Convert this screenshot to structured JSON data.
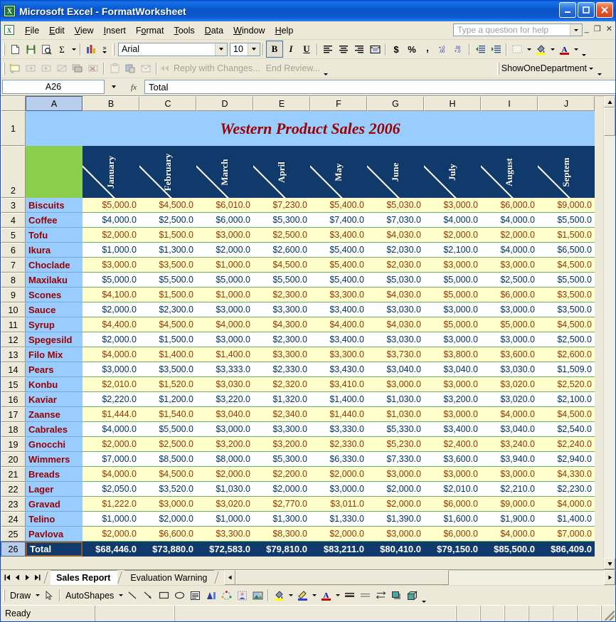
{
  "window": {
    "title": "Microsoft Excel - FormatWorksheet",
    "app_icon": "excel-icon",
    "minimize_label": "_",
    "maximize_label": "□",
    "close_label": "✕"
  },
  "menubar": {
    "items": [
      {
        "label": "File",
        "accel": "F"
      },
      {
        "label": "Edit",
        "accel": "E"
      },
      {
        "label": "View",
        "accel": "V"
      },
      {
        "label": "Insert",
        "accel": "I"
      },
      {
        "label": "Format",
        "accel": "o"
      },
      {
        "label": "Tools",
        "accel": "T"
      },
      {
        "label": "Data",
        "accel": "D"
      },
      {
        "label": "Window",
        "accel": "W"
      },
      {
        "label": "Help",
        "accel": "H"
      }
    ],
    "ask_placeholder": "Type a question for help",
    "doc_minimize": "_",
    "doc_restore": "❐",
    "doc_close": "✕"
  },
  "toolbar": {
    "buttons": [
      {
        "name": "new-icon",
        "label": "New"
      },
      {
        "name": "save-icon",
        "label": "Save"
      },
      {
        "name": "print-preview-icon",
        "label": "Print Preview"
      },
      {
        "name": "autosum-icon",
        "label": "AutoSum"
      },
      {
        "name": "chart-wizard-icon",
        "label": "Chart Wizard"
      }
    ],
    "overflow_label": "»",
    "font_name": "Arial",
    "font_size": "10",
    "bold_label": "B",
    "italic_label": "I",
    "underline_label": "U",
    "align_left": "Align Left",
    "align_center": "Center",
    "align_right": "Align Right",
    "merge_center": "Merge and Center",
    "currency_label": "$",
    "percent_label": "%",
    "comma_label": ",",
    "increase_decimal": "Increase Decimal",
    "decrease_decimal": "Decrease Decimal",
    "decrease_indent": "Decrease Indent",
    "increase_indent": "Increase Indent",
    "borders_label": "Borders",
    "fill_color_label": "Fill Color",
    "font_color_label": "A"
  },
  "reviewing_toolbar": {
    "reply_with_changes": "Reply with Changes...",
    "end_review": "End Review...",
    "macro_button": "ShowOneDepartment"
  },
  "formula_bar": {
    "name_box": "A26",
    "fx_label": "fx",
    "formula_value": "Total"
  },
  "grid": {
    "column_headers": [
      "A",
      "B",
      "C",
      "D",
      "E",
      "F",
      "G",
      "H",
      "I",
      "J"
    ],
    "selected_column": "A",
    "selected_row": "26",
    "row_numbers": [
      "1",
      "2",
      "3",
      "4",
      "5",
      "6",
      "7",
      "8",
      "9",
      "10",
      "11",
      "12",
      "13",
      "14",
      "15",
      "16",
      "17",
      "18",
      "19",
      "20",
      "21",
      "22",
      "23",
      "24",
      "25",
      "26"
    ],
    "sheet_title": "Western Product Sales 2006",
    "month_headers": [
      "January",
      "February",
      "March",
      "April",
      "May",
      "June",
      "July",
      "August",
      "Septem"
    ],
    "total_label": "Total"
  },
  "chart_data": {
    "type": "table",
    "title": "Western Product Sales 2006",
    "categories": [
      "January",
      "February",
      "March",
      "April",
      "May",
      "June",
      "July",
      "August",
      "Septem"
    ],
    "rows": [
      {
        "row": "3",
        "product": "Biscuits",
        "values": [
          "$5,000.0",
          "$4,500.0",
          "$6,010.0",
          "$7,230.0",
          "$5,400.0",
          "$5,030.0",
          "$3,000.0",
          "$6,000.0",
          "$9,000.0"
        ]
      },
      {
        "row": "4",
        "product": "Coffee",
        "values": [
          "$4,000.0",
          "$2,500.0",
          "$6,000.0",
          "$5,300.0",
          "$7,400.0",
          "$7,030.0",
          "$4,000.0",
          "$4,000.0",
          "$5,500.0"
        ]
      },
      {
        "row": "5",
        "product": "Tofu",
        "values": [
          "$2,000.0",
          "$1,500.0",
          "$3,000.0",
          "$2,500.0",
          "$3,400.0",
          "$4,030.0",
          "$2,000.0",
          "$2,000.0",
          "$1,500.0"
        ]
      },
      {
        "row": "6",
        "product": "Ikura",
        "values": [
          "$1,000.0",
          "$1,300.0",
          "$2,000.0",
          "$2,600.0",
          "$5,400.0",
          "$2,030.0",
          "$2,100.0",
          "$4,000.0",
          "$6,500.0"
        ]
      },
      {
        "row": "7",
        "product": "Choclade",
        "values": [
          "$3,000.0",
          "$3,500.0",
          "$1,000.0",
          "$4,500.0",
          "$5,400.0",
          "$2,030.0",
          "$3,000.0",
          "$3,000.0",
          "$4,500.0"
        ]
      },
      {
        "row": "8",
        "product": "Maxilaku",
        "values": [
          "$5,000.0",
          "$5,500.0",
          "$5,000.0",
          "$5,500.0",
          "$5,400.0",
          "$5,030.0",
          "$5,000.0",
          "$2,500.0",
          "$5,500.0"
        ]
      },
      {
        "row": "9",
        "product": "Scones",
        "values": [
          "$4,100.0",
          "$1,500.0",
          "$1,000.0",
          "$2,300.0",
          "$3,300.0",
          "$4,030.0",
          "$5,000.0",
          "$6,000.0",
          "$3,500.0"
        ]
      },
      {
        "row": "10",
        "product": "Sauce",
        "values": [
          "$2,000.0",
          "$2,300.0",
          "$3,000.0",
          "$3,300.0",
          "$3,400.0",
          "$3,030.0",
          "$3,000.0",
          "$3,000.0",
          "$3,500.0"
        ]
      },
      {
        "row": "11",
        "product": "Syrup",
        "values": [
          "$4,400.0",
          "$4,500.0",
          "$4,000.0",
          "$4,300.0",
          "$4,400.0",
          "$4,030.0",
          "$5,000.0",
          "$5,000.0",
          "$4,500.0"
        ]
      },
      {
        "row": "12",
        "product": "Spegesild",
        "values": [
          "$2,000.0",
          "$1,500.0",
          "$3,000.0",
          "$2,300.0",
          "$3,400.0",
          "$3,030.0",
          "$3,000.0",
          "$3,000.0",
          "$2,500.0"
        ]
      },
      {
        "row": "13",
        "product": "Filo Mix",
        "values": [
          "$4,000.0",
          "$1,400.0",
          "$1,400.0",
          "$3,300.0",
          "$3,300.0",
          "$3,730.0",
          "$3,800.0",
          "$3,600.0",
          "$2,600.0"
        ]
      },
      {
        "row": "14",
        "product": "Pears",
        "values": [
          "$3,000.0",
          "$3,500.0",
          "$3,333.0",
          "$2,330.0",
          "$3,430.0",
          "$3,040.0",
          "$3,040.0",
          "$3,030.0",
          "$1,509.0"
        ]
      },
      {
        "row": "15",
        "product": "Konbu",
        "values": [
          "$2,010.0",
          "$1,520.0",
          "$3,030.0",
          "$2,320.0",
          "$3,410.0",
          "$3,000.0",
          "$3,000.0",
          "$3,020.0",
          "$2,520.0"
        ]
      },
      {
        "row": "16",
        "product": "Kaviar",
        "values": [
          "$2,220.0",
          "$1,200.0",
          "$3,220.0",
          "$1,320.0",
          "$1,400.0",
          "$1,030.0",
          "$3,200.0",
          "$3,020.0",
          "$2,100.0"
        ]
      },
      {
        "row": "17",
        "product": "Zaanse",
        "values": [
          "$1,444.0",
          "$1,540.0",
          "$3,040.0",
          "$2,340.0",
          "$1,440.0",
          "$1,030.0",
          "$3,000.0",
          "$4,000.0",
          "$4,500.0"
        ]
      },
      {
        "row": "18",
        "product": "Cabrales",
        "values": [
          "$4,000.0",
          "$5,500.0",
          "$3,000.0",
          "$3,300.0",
          "$3,330.0",
          "$5,330.0",
          "$3,400.0",
          "$3,040.0",
          "$2,540.0"
        ]
      },
      {
        "row": "19",
        "product": "Gnocchi",
        "values": [
          "$2,000.0",
          "$2,500.0",
          "$3,200.0",
          "$3,200.0",
          "$2,330.0",
          "$5,230.0",
          "$2,400.0",
          "$3,240.0",
          "$2,240.0"
        ]
      },
      {
        "row": "20",
        "product": "Wimmers",
        "values": [
          "$7,000.0",
          "$8,500.0",
          "$8,000.0",
          "$5,300.0",
          "$6,330.0",
          "$7,330.0",
          "$3,600.0",
          "$3,940.0",
          "$2,940.0"
        ]
      },
      {
        "row": "21",
        "product": "Breads",
        "values": [
          "$4,000.0",
          "$4,500.0",
          "$2,000.0",
          "$2,200.0",
          "$2,000.0",
          "$3,000.0",
          "$3,000.0",
          "$3,000.0",
          "$4,330.0"
        ]
      },
      {
        "row": "22",
        "product": "Lager",
        "values": [
          "$2,050.0",
          "$3,520.0",
          "$1,030.0",
          "$2,000.0",
          "$3,000.0",
          "$2,000.0",
          "$2,010.0",
          "$2,210.0",
          "$2,230.0"
        ]
      },
      {
        "row": "23",
        "product": "Gravad",
        "values": [
          "$1,222.0",
          "$3,000.0",
          "$3,020.0",
          "$2,770.0",
          "$3,011.0",
          "$2,000.0",
          "$6,000.0",
          "$9,000.0",
          "$4,000.0"
        ]
      },
      {
        "row": "24",
        "product": "Telino",
        "values": [
          "$1,000.0",
          "$2,000.0",
          "$1,000.0",
          "$1,300.0",
          "$1,330.0",
          "$1,390.0",
          "$1,600.0",
          "$1,900.0",
          "$1,400.0"
        ]
      },
      {
        "row": "25",
        "product": "Pavlova",
        "values": [
          "$2,000.0",
          "$6,600.0",
          "$3,300.0",
          "$8,300.0",
          "$2,000.0",
          "$3,000.0",
          "$6,000.0",
          "$4,000.0",
          "$7,000.0"
        ]
      }
    ],
    "totals": {
      "label": "Total",
      "values": [
        "$68,446.0",
        "$73,880.0",
        "$72,583.0",
        "$79,810.0",
        "$83,211.0",
        "$80,410.0",
        "$79,150.0",
        "$85,500.0",
        "$86,409.0"
      ]
    },
    "colors": {
      "title_bg": "#99ccff",
      "title_text": "#990000",
      "header_navy": "#103a6b",
      "header_green": "#8ccf4e",
      "odd_row_bg": "#ffffcc",
      "odd_row_text": "#993300",
      "even_row_bg": "#ffffff",
      "even_row_text": "#003366",
      "name_col_bg": "#99ccff",
      "total_bg": "#103a6b",
      "total_text": "#ffffff"
    }
  },
  "sheet_tabs": {
    "first_label": "|◀",
    "prev_label": "◀",
    "next_label": "▶",
    "last_label": "▶|",
    "tabs": [
      {
        "label": "Sales Report",
        "active": true
      },
      {
        "label": "Evaluation Warning",
        "active": false
      }
    ]
  },
  "drawing_toolbar": {
    "draw_label": "Draw",
    "select_objects": "select-objects-icon",
    "autoshapes_label": "AutoShapes",
    "tools": [
      {
        "name": "line-icon"
      },
      {
        "name": "arrow-icon"
      },
      {
        "name": "rectangle-icon"
      },
      {
        "name": "oval-icon"
      },
      {
        "name": "text-box-icon"
      },
      {
        "name": "wordart-icon"
      },
      {
        "name": "diagram-icon"
      },
      {
        "name": "clip-art-icon"
      },
      {
        "name": "picture-icon"
      },
      {
        "name": "fill-color-icon"
      },
      {
        "name": "line-color-icon"
      },
      {
        "name": "font-color-icon"
      },
      {
        "name": "line-style-icon"
      },
      {
        "name": "dash-style-icon"
      },
      {
        "name": "arrow-style-icon"
      },
      {
        "name": "shadow-style-icon"
      },
      {
        "name": "3d-style-icon"
      }
    ]
  },
  "status_bar": {
    "status_text": "Ready"
  }
}
